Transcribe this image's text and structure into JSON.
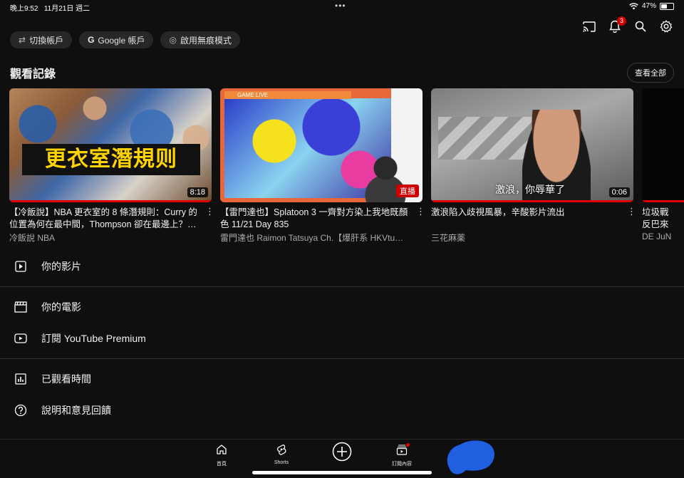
{
  "status_bar": {
    "time": "晚上9:52",
    "date": "11月21日 週二",
    "dots": "•••",
    "battery_percent": "47%",
    "battery_level": 0.47
  },
  "header": {
    "notification_count": "3"
  },
  "chips": [
    {
      "label": "切換帳戶",
      "icon": "switch-account-icon"
    },
    {
      "label": "Google 帳戶",
      "icon": "google-g-icon"
    },
    {
      "label": "啟用無痕模式",
      "icon": "incognito-icon"
    }
  ],
  "history": {
    "title": "觀看記錄",
    "view_all": "查看全部",
    "videos": [
      {
        "title": "【冷飯說】NBA 更衣室的 8 條潛規則：Curry 的位置為何在最中間，Thompson 卻在最邊上？…",
        "channel": "冷飯說 NBA",
        "duration": "8:18",
        "thumb_text": "更衣室潛規则",
        "progress": 1.0
      },
      {
        "title": "【雷門達也】Splatoon 3 一齊對方染上我地既顏色 11/21 Day 835",
        "channel": "雷門達也 Raimon Tatsuya Ch.【爆肝系 HKVtu…",
        "badge": "直播",
        "thumb_text": "GAME LIVE",
        "progress": 0.0
      },
      {
        "title": "激浪陷入歧視風暴，辛酸影片流出",
        "channel": "三花麻薬",
        "duration": "0:06",
        "thumb_text": "激浪，你辱華了",
        "progress": 1.0
      },
      {
        "title": "垃圾戰反巴來是!?」",
        "channel": "DE JuN",
        "progress": 1.0
      }
    ]
  },
  "menu": [
    {
      "label": "你的影片",
      "icon": "play-square-icon"
    },
    {
      "label": "你的電影",
      "icon": "clapperboard-icon"
    },
    {
      "label": "訂閱 YouTube Premium",
      "icon": "youtube-icon"
    },
    {
      "label": "已觀看時間",
      "icon": "bar-chart-icon"
    },
    {
      "label": "說明和意見回饋",
      "icon": "help-icon"
    }
  ],
  "bottom_nav": {
    "home": "首頁",
    "shorts": "Shorts",
    "create": "create-icon",
    "subscriptions": "訂閱內容"
  },
  "colors": {
    "background": "#0f0f0f",
    "accent_red": "#cc0000",
    "text_secondary": "#aaaaaa",
    "blob": "#1f5fe0"
  }
}
